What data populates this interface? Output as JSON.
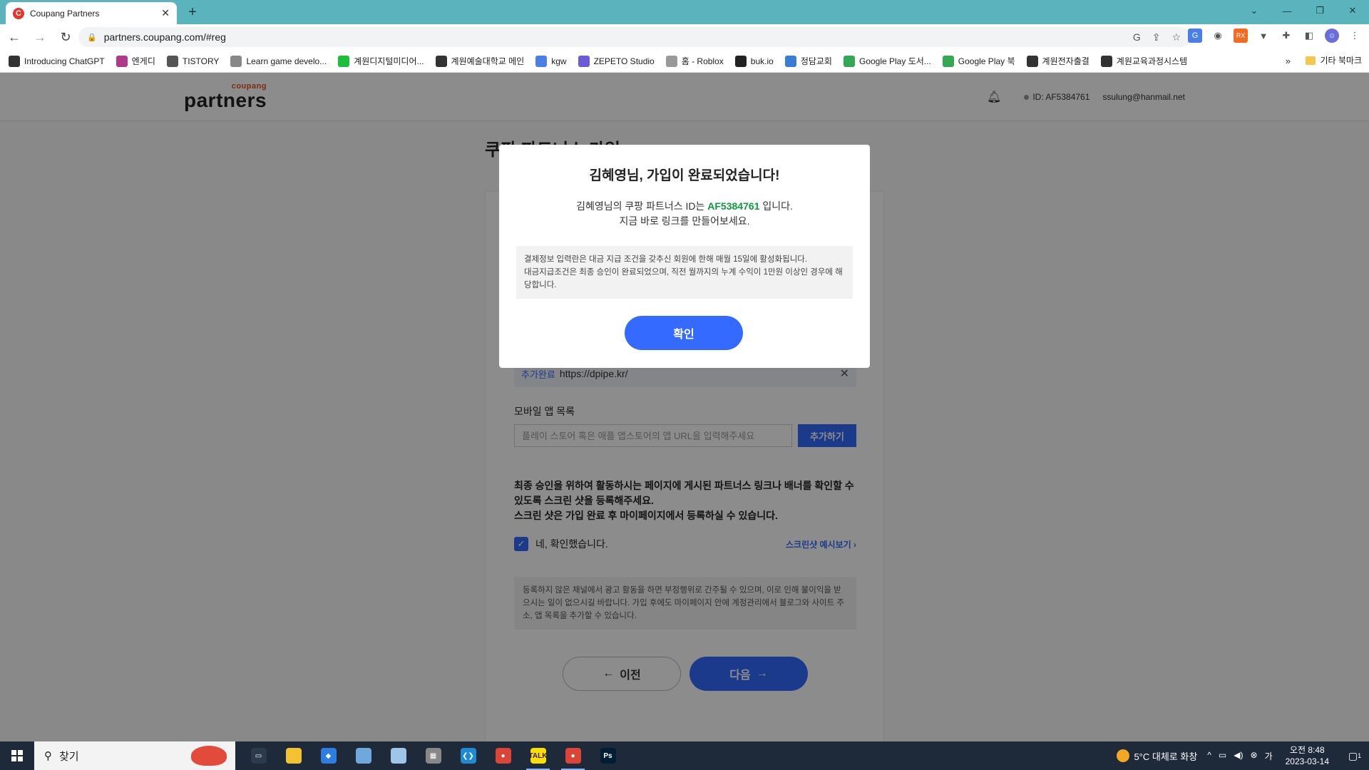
{
  "browser": {
    "tab_title": "Coupang Partners",
    "tab_favicon": "C",
    "url": "partners.coupang.com/#reg",
    "bookmarks": [
      {
        "label": "Introducing ChatGPT",
        "color": "#333333"
      },
      {
        "label": "엔게디",
        "color": "#b03a8a"
      },
      {
        "label": "TISTORY",
        "color": "#555555"
      },
      {
        "label": "Learn game develo...",
        "color": "#888888"
      },
      {
        "label": "계원디지털미디어...",
        "color": "#1dbf3a"
      },
      {
        "label": "계원예술대학교 메인",
        "color": "#333333"
      },
      {
        "label": "kgw",
        "color": "#4a7ee8"
      },
      {
        "label": "ZEPETO Studio",
        "color": "#6b5bd6"
      },
      {
        "label": "홈 - Roblox",
        "color": "#999999"
      },
      {
        "label": "buk.io",
        "color": "#222222"
      },
      {
        "label": "정담교회",
        "color": "#3a7bd5"
      },
      {
        "label": "Google Play 도서...",
        "color": "#34a853"
      },
      {
        "label": "Google Play 북",
        "color": "#34a853"
      },
      {
        "label": "계원전자출결",
        "color": "#333333"
      },
      {
        "label": "계원교육과정시스템",
        "color": "#333333"
      }
    ],
    "bookmarks_more": "»",
    "other_bookmarks": "기타 북마크"
  },
  "header": {
    "logo_small": "coupang",
    "logo_big": "partners",
    "user_id": "ID: AF5384761",
    "email": "ssulung@hanmail.net"
  },
  "form": {
    "page_title": "쿠팡 파트너스 가입",
    "added_tag": "추가완료",
    "added_url": "https://dpipe.kr/",
    "mobile_label": "모바일 앱 목록",
    "app_placeholder": "플레이 스토어 혹은 애플 앱스토어의 앱 URL을 입력해주세요",
    "add_button": "추가하기",
    "notice_line1": "최종 승인을 위하여 활동하시는 페이지에 게시된 파트너스 링크나 배너를 확인할 수 있도록 스크린 샷을 등록해주세요.",
    "notice_line2": "스크린 샷은 가입 완료 후 마이페이지에서 등록하실 수 있습니다.",
    "check_label": "네, 확인했습니다.",
    "example_link": "스크린샷 예시보기 ›",
    "warning_text": "등록하지 않은 채널에서 광고 활동을 하면 부정행위로 간주될 수 있으며, 이로 인해 불이익을 받으시는 일이 없으시길 바랍니다. 가입 후에도 마이페이지 안에 계정관리에서 블로그와 사이트 주소, 앱 목록을 추가할 수 있습니다.",
    "prev_button": "이전",
    "next_button": "다음"
  },
  "modal": {
    "title": "김혜영님, 가입이 완료되었습니다!",
    "body_prefix": "김혜영님의 쿠팡 파트너스 ID는 ",
    "partner_id": "AF5384761",
    "body_suffix": " 입니다.",
    "body_line2": "지금 바로 링크를 만들어보세요.",
    "note_line1": "결제정보 입력란은 대금 지급 조건을 갖추신 회원에 한해 매월 15일에 활성화됩니다.",
    "note_line2": "대금지급조건은 최종 승인이 완료되었으며, 직전 월까지의 누계 수익이 1만원 이상인 경우에 해당합니다.",
    "confirm_button": "확인"
  },
  "taskbar": {
    "search_label": "찾기",
    "weather": "5°C  대체로 화창",
    "time": "오전 8:48",
    "date": "2023-03-14",
    "notification_count": "1",
    "apps": [
      {
        "name": "task-view",
        "color": "#2b3a4d",
        "label": "▭",
        "active": false
      },
      {
        "name": "file-explorer",
        "color": "#f2c230",
        "label": "",
        "active": false
      },
      {
        "name": "blue-app",
        "color": "#2e7de0",
        "label": "◆",
        "active": false
      },
      {
        "name": "notepad",
        "color": "#6fa8dc",
        "label": "",
        "active": false
      },
      {
        "name": "paint",
        "color": "#9fc5e8",
        "label": "",
        "active": false
      },
      {
        "name": "calculator",
        "color": "#888888",
        "label": "▦",
        "active": false
      },
      {
        "name": "vscode",
        "color": "#1f8ad2",
        "label": "❮❯",
        "active": false
      },
      {
        "name": "chrome",
        "color": "#db4437",
        "label": "●",
        "active": false
      },
      {
        "name": "kakaotalk",
        "color": "#f9e000",
        "label": "TALK",
        "active": true
      },
      {
        "name": "chrome-active",
        "color": "#db4437",
        "label": "●",
        "active": true
      },
      {
        "name": "photoshop",
        "color": "#001e36",
        "label": "Ps",
        "active": false
      }
    ]
  }
}
